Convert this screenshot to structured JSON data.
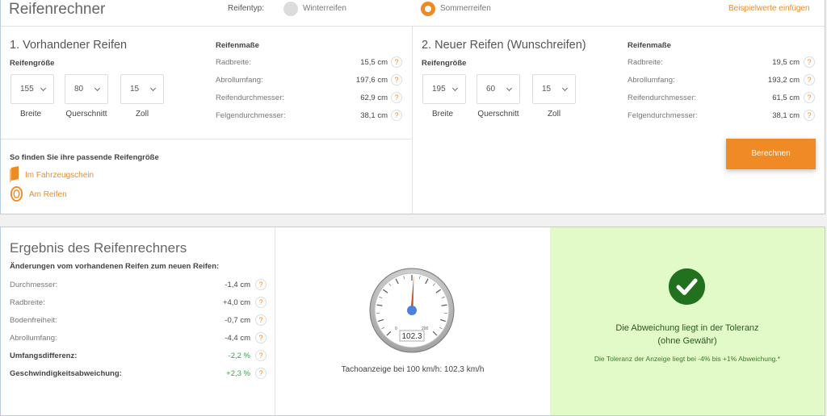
{
  "app": {
    "title": "Reifenrechner"
  },
  "tire_type": {
    "label": "Reifentyp:",
    "options": [
      {
        "label": "Winterreifen",
        "selected": false
      },
      {
        "label": "Sommerreifen",
        "selected": true
      }
    ]
  },
  "example_link": "Beispielwerte einfügen",
  "existing": {
    "title": "1. Vorhandener Reifen",
    "size_label": "Reifengröße",
    "width": {
      "value": "155",
      "label": "Breite"
    },
    "profile": {
      "value": "80",
      "label": "Querschnitt"
    },
    "rim": {
      "value": "15",
      "label": "Zoll"
    },
    "dims_title": "Reifenmaße",
    "dims": [
      {
        "label": "Radbreite:",
        "value": "15,5 cm"
      },
      {
        "label": "Abrollumfang:",
        "value": "197,6 cm"
      },
      {
        "label": "Reifendurchmesser:",
        "value": "62,9 cm"
      },
      {
        "label": "Felgendurchmesser:",
        "value": "38,1 cm"
      }
    ]
  },
  "new": {
    "title": "2. Neuer Reifen (Wunschreifen)",
    "size_label": "Reifengröße",
    "width": {
      "value": "195",
      "label": "Breite"
    },
    "profile": {
      "value": "60",
      "label": "Querschnitt"
    },
    "rim": {
      "value": "15",
      "label": "Zoll"
    },
    "dims_title": "Reifenmaße",
    "dims": [
      {
        "label": "Radbreite:",
        "value": "19,5 cm"
      },
      {
        "label": "Abrollumfang:",
        "value": "193,2 cm"
      },
      {
        "label": "Reifendurchmesser:",
        "value": "61,5 cm"
      },
      {
        "label": "Felgendurchmesser:",
        "value": "38,1 cm"
      }
    ]
  },
  "help_mark": "?",
  "find": {
    "title": "So finden Sie ihre passende Reifengröße",
    "link_registration": "Im Fahrzeugschein",
    "link_tire": "Am Reifen"
  },
  "calculate_button": "Berechnen",
  "result": {
    "title": "Ergebnis des Reifenrechners",
    "subtitle": "Änderungen vom vorhandenen Reifen zum neuen Reifen:",
    "rows": [
      {
        "label": "Durchmesser:",
        "value": "-1,4 cm"
      },
      {
        "label": "Radbreite:",
        "value": "+4,0 cm"
      },
      {
        "label": "Bodenfreiheit:",
        "value": "-0,7 cm"
      },
      {
        "label": "Abrollumfang:",
        "value": "-4,4 cm"
      },
      {
        "label": "Umfangsdifferenz:",
        "value": "-2,2 %"
      },
      {
        "label": "Geschwindigkeitsabweichung:",
        "value": "+2,3 %"
      }
    ]
  },
  "gauge": {
    "reading": "102.3",
    "value": 102.3,
    "max": 200,
    "tick_min": "0",
    "tick_max": "200",
    "caption": "Tachoanzeige bei 100 km/h: 102,3 km/h"
  },
  "tolerance": {
    "headline_1": "Die Abweichung liegt in der Toleranz",
    "headline_2": "(ohne Gewähr)",
    "note": "Die Toleranz der Anzeige liegt bei -4% bis +1% Abweichung.*"
  },
  "colors": {
    "accent": "#f08a24",
    "success_bg": "#e1fac8",
    "success_icon": "#22711f",
    "positive_value": "#3aa24a"
  }
}
